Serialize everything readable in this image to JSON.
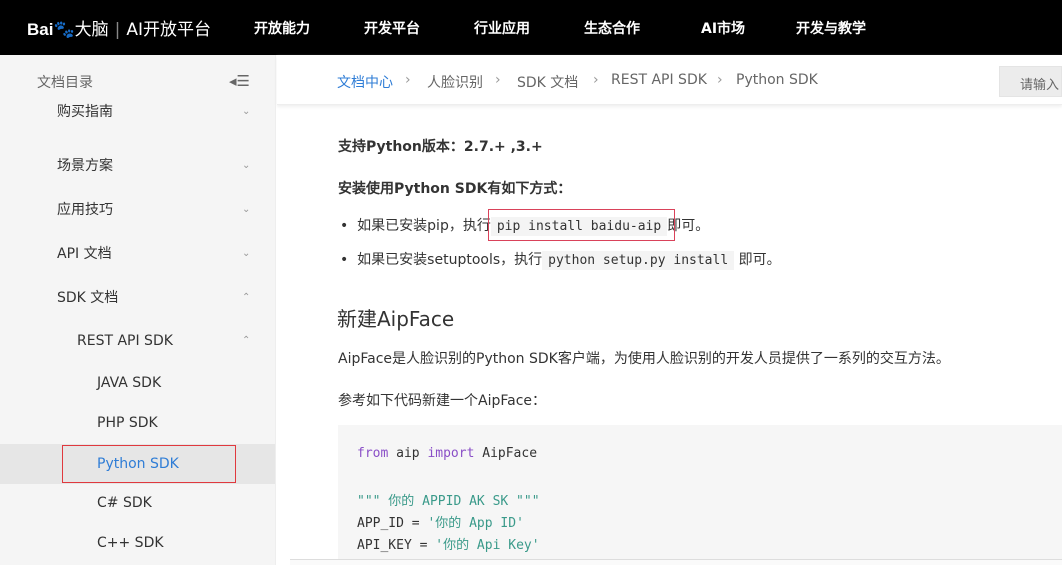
{
  "header": {
    "logo_brand": "Bai",
    "logo_du": "du",
    "logo_brain": "大脑",
    "logo_platform": "AI开放平台",
    "nav": [
      "开放能力",
      "开发平台",
      "行业应用",
      "生态合作",
      "AI市场",
      "开发与教学"
    ]
  },
  "sidebar": {
    "title": "文档目录",
    "items": [
      {
        "label": "购买指南",
        "chev": "⌄"
      },
      {
        "label": "场景方案",
        "chev": "⌄"
      },
      {
        "label": "应用技巧",
        "chev": "⌄"
      },
      {
        "label": "API 文档",
        "chev": "⌄"
      },
      {
        "label": "SDK 文档",
        "chev": "⌃"
      },
      {
        "label": "REST API SDK",
        "chev": "⌃"
      },
      {
        "label": "JAVA SDK"
      },
      {
        "label": "PHP SDK"
      },
      {
        "label": "Python SDK"
      },
      {
        "label": "C# SDK"
      },
      {
        "label": "C++ SDK"
      }
    ]
  },
  "breadcrumb": [
    "文档中心",
    "人脸识别",
    "SDK 文档",
    "REST API SDK",
    "Python SDK"
  ],
  "search": {
    "placeholder": "请输入"
  },
  "content": {
    "version": "支持Python版本：2.7.+ ,3.+",
    "install_title": "安装使用Python SDK有如下方式：",
    "b1_pre": "如果已安装pip，执行",
    "b1_code": "pip install baidu-aip",
    "b1_post": "即可。",
    "b2_pre": "如果已安装setuptools，执行",
    "b2_code": "python setup.py install",
    "b2_post": "即可。",
    "h2": "新建AipFace",
    "desc": "AipFace是人脸识别的Python SDK客户端，为使用人脸识别的开发人员提供了一系列的交互方法。",
    "ref": "参考如下代码新建一个AipFace：",
    "code": {
      "l1a": "from",
      "l1b": " aip ",
      "l1c": "import",
      "l1d": " AipFace",
      "l2": "\"\"\" 你的 APPID AK SK \"\"\"",
      "l3a": "APP_ID = ",
      "l3b": "'你的 App ID'",
      "l4a": "API_KEY = ",
      "l4b": "'你的 Api Key'"
    }
  }
}
